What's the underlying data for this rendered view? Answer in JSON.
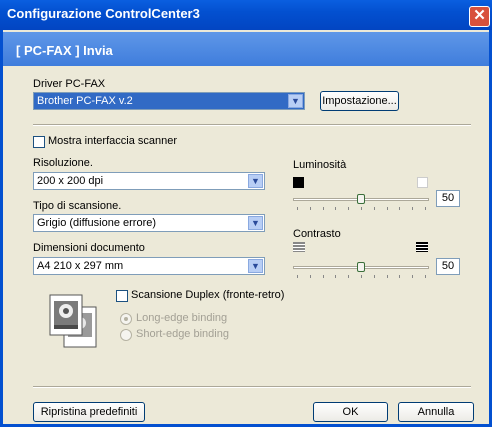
{
  "window": {
    "title": "Configurazione ControlCenter3",
    "close_glyph": "✕"
  },
  "header": {
    "text": "[ PC-FAX ]  Invia"
  },
  "driver": {
    "label": "Driver PC-FAX",
    "value": "Brother PC-FAX v.2",
    "settings_button": "Impostazione..."
  },
  "scanner": {
    "show_interface_label": "Mostra interfaccia scanner",
    "resolution_label": "Risoluzione.",
    "resolution_value": "200 x 200 dpi",
    "scan_type_label": "Tipo di scansione.",
    "scan_type_value": "Grigio (diffusione errore)",
    "doc_size_label": "Dimensioni documento",
    "doc_size_value": "A4 210 x 297 mm"
  },
  "brightness": {
    "label": "Luminosità",
    "value": "50",
    "level": 0.5
  },
  "contrast": {
    "label": "Contrasto",
    "value": "50",
    "level": 0.5
  },
  "duplex": {
    "label": "Scansione Duplex (fronte-retro)",
    "long_edge": "Long-edge binding",
    "short_edge": "Short-edge binding"
  },
  "footer": {
    "reset_button": "Ripristina predefiniti",
    "ok_button": "OK",
    "cancel_button": "Annulla"
  }
}
